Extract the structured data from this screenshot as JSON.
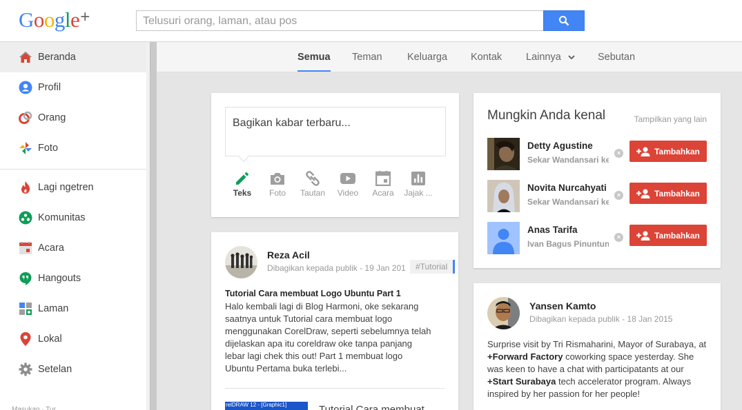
{
  "header": {
    "logo_text": "Google",
    "logo_plus": "+",
    "search_placeholder": "Telusuri orang, laman, atau pos"
  },
  "sidebar": {
    "items": [
      {
        "label": "Beranda",
        "icon": "home-icon"
      },
      {
        "label": "Profil",
        "icon": "profile-icon"
      },
      {
        "label": "Orang",
        "icon": "people-icon"
      },
      {
        "label": "Foto",
        "icon": "photos-icon"
      },
      {
        "label": "Lagi ngetren",
        "icon": "trending-icon"
      },
      {
        "label": "Komunitas",
        "icon": "communities-icon"
      },
      {
        "label": "Acara",
        "icon": "events-icon"
      },
      {
        "label": "Hangouts",
        "icon": "hangouts-icon"
      },
      {
        "label": "Laman",
        "icon": "pages-icon"
      },
      {
        "label": "Lokal",
        "icon": "local-icon"
      },
      {
        "label": "Setelan",
        "icon": "settings-icon"
      }
    ],
    "footer": "Masukan · Tur"
  },
  "tabs": [
    "Semua",
    "Teman",
    "Keluarga",
    "Kontak",
    "Lainnya",
    "Sebutan"
  ],
  "share": {
    "prompt": "Bagikan kabar terbaru...",
    "options": [
      "Teks",
      "Foto",
      "Tautan",
      "Video",
      "Acara",
      "Jajak ..."
    ]
  },
  "suggestions": {
    "title": "Mungkin Anda kenal",
    "more": "Tampilkan yang lain",
    "add_label": "Tambahkan",
    "people": [
      {
        "name": "Detty Agustine",
        "sub": "Sekar Wandansari ke"
      },
      {
        "name": "Novita Nurcahyati",
        "sub": "Sekar Wandansari ke"
      },
      {
        "name": "Anas Tarifa",
        "sub": "Ivan Bagus Pinuntun"
      }
    ]
  },
  "post1": {
    "author": "Reza Acil",
    "meta": "Dibagikan kepada publik  -  19 Jan 201",
    "tag": "#Tutorial",
    "headline": "Tutorial Cara membuat Logo Ubuntu Part 1",
    "body": "Halo kembali lagi di Blog Harmoni, oke sekarang saatnya untuk Tutorial cara membuat logo menggunakan CorelDraw, seperti sebelumnya telah dijelaskan apa itu coreldraw oke tanpa panjang lebar lagi chek this out! Part 1 membuat logo Ubuntu Pertama buka terlebi...",
    "thumb_caption": "relDRAW 12 - [Graphic1]",
    "link_title": "Tutorial Cara membuat"
  },
  "post2": {
    "author": "Yansen Kamto",
    "meta": "Dibagikan kepada publik  -  18 Jan 2015",
    "body_pre": "Surprise visit by Tri Rismaharini, Mayor of Surabaya, at ",
    "mention1": "+Forward Factory",
    "body_mid": " coworking space yesterday. She was keen to have a chat with participatants at our ",
    "mention2": "+Start Surabaya",
    "body_post": " tech accelerator program. Always inspired by her passion for her people!"
  },
  "colors": {
    "accent": "#4285f4",
    "add_button": "#db4437",
    "share_active": "#0f9d58"
  }
}
